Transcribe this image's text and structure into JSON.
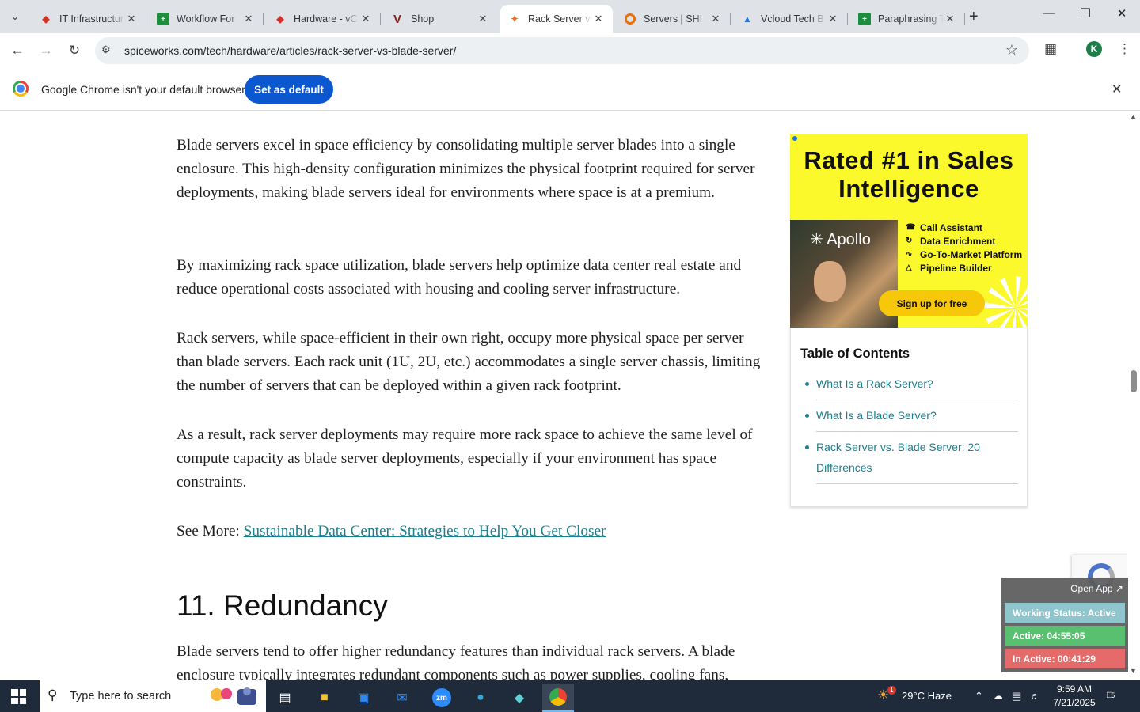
{
  "browser": {
    "tabs": [
      {
        "title": "IT Infrastructure",
        "favicon": "red-diamond"
      },
      {
        "title": "Workflow For",
        "favicon": "green-sheet"
      },
      {
        "title": "Hardware - vC",
        "favicon": "red-diamond"
      },
      {
        "title": "Shop",
        "favicon": "v-logo"
      },
      {
        "title": "Rack Server vs",
        "favicon": "spiceworks-logo",
        "active": true
      },
      {
        "title": "Servers | SHI",
        "favicon": "shi-logo"
      },
      {
        "title": "Vcloud Tech B",
        "favicon": "google-drive"
      },
      {
        "title": "Paraphrasing T",
        "favicon": "green-sheet"
      }
    ],
    "url": "spiceworks.com/tech/hardware/articles/rack-server-vs-blade-server/",
    "profile_initial": "K",
    "infobar": {
      "message": "Google Chrome isn't your default browser",
      "button": "Set as default"
    }
  },
  "article": {
    "paragraphs": [
      "Blade servers excel in space efficiency by consolidating multiple server blades into a single enclosure. This high-density configuration minimizes the physical footprint required for server deployments, making blade servers ideal for environments where space is at a premium.",
      "By maximizing rack space utilization, blade servers help optimize data center real estate and reduce operational costs associated with housing and cooling server infrastructure.",
      "Rack servers, while space-efficient in their own right, occupy more physical space per server than blade servers. Each rack unit (1U, 2U, etc.) accommodates a single server chassis, limiting the number of servers that can be deployed within a given rack footprint.",
      "As a result, rack server deployments may require more rack space to achieve the same level of compute capacity as blade server deployments, especially if your environment has space constraints."
    ],
    "see_more_prefix": "See More: ",
    "see_more_link": "Sustainable Data Center: Strategies to Help You Get Closer",
    "heading": "11. Redundancy",
    "next_paragraph": "Blade servers tend to offer higher redundancy features than individual rack servers. A blade enclosure typically integrates redundant components such as power supplies, cooling fans,"
  },
  "ad": {
    "headline": "Rated #1 in Sales Intelligence",
    "brand": "Apollo",
    "features": [
      "Call Assistant",
      "Data Enrichment",
      "Go-To-Market Platform",
      "Pipeline Builder"
    ],
    "cta": "Sign up for free",
    "bg_color": "#fbf82b"
  },
  "toc": {
    "title": "Table of Contents",
    "items": [
      "What Is a Rack Server?",
      "What Is a Blade Server?",
      "Rack Server vs. Blade Server: 20 Differences"
    ]
  },
  "widget": {
    "open_app": "Open App ↗",
    "working_status": "Working Status: Active",
    "active": "Active: 04:55:05",
    "inactive": "In Active: 00:41:29"
  },
  "taskbar": {
    "search_placeholder": "Type here to search",
    "weather": "29°C  Haze",
    "weather_badge": "1",
    "time": "9:59 AM",
    "date": "7/21/2025",
    "notifications": "5"
  }
}
